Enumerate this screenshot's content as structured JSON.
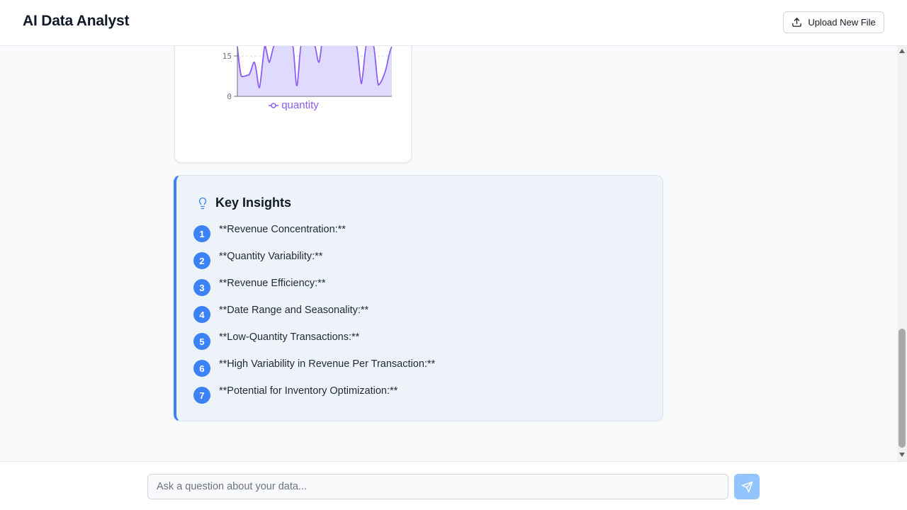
{
  "header": {
    "title": "AI Data Analyst",
    "upload_label": "Upload New File"
  },
  "chart_data": {
    "type": "area",
    "y_ticks": [
      "15",
      "0"
    ],
    "legend": [
      "quantity"
    ],
    "series": [
      {
        "name": "quantity"
      }
    ],
    "colors": {
      "stroke": "#8b5cf6",
      "fill": "#ddd6fe"
    }
  },
  "insights": {
    "title": "Key Insights",
    "items": [
      {
        "num": "1",
        "text": "**Revenue Concentration:**"
      },
      {
        "num": "2",
        "text": "**Quantity Variability:**"
      },
      {
        "num": "3",
        "text": "**Revenue Efficiency:**"
      },
      {
        "num": "4",
        "text": "**Date Range and Seasonality:**"
      },
      {
        "num": "5",
        "text": "**Low-Quantity Transactions:**"
      },
      {
        "num": "6",
        "text": "**High Variability in Revenue Per Transaction:**"
      },
      {
        "num": "7",
        "text": "**Potential for Inventory Optimization:**"
      }
    ]
  },
  "chat": {
    "placeholder": "Ask a question about your data..."
  },
  "colors": {
    "accent": "#3b82f6",
    "chart": "#8b5cf6"
  }
}
